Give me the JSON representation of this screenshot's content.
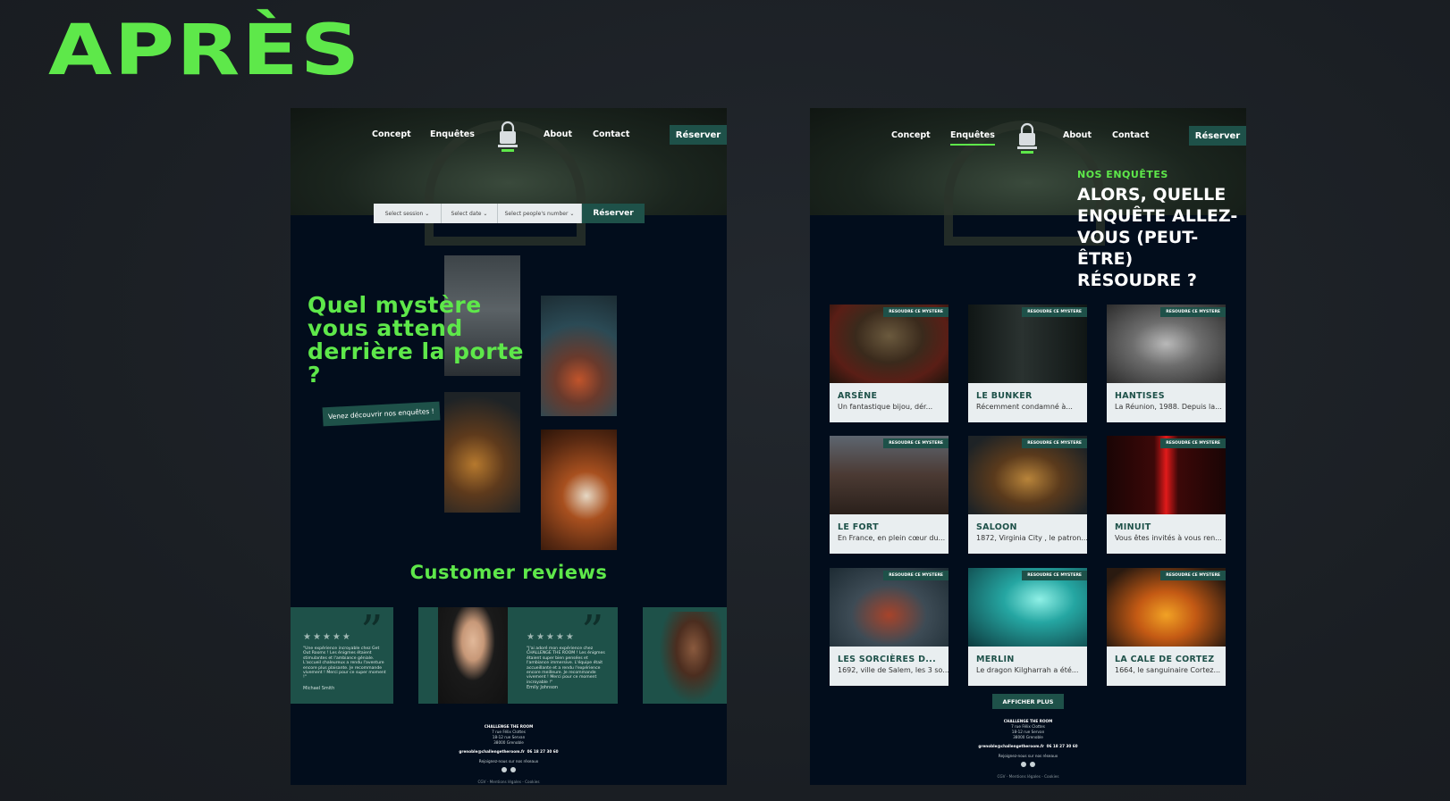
{
  "heading": "APRÈS",
  "nav": {
    "concept": "Concept",
    "enquetes": "Enquêtes",
    "about": "About",
    "contact": "Contact",
    "reserve": "Réserver"
  },
  "booking": {
    "session": "Select session",
    "date": "Select date",
    "people": "Select people's number",
    "button": "Réserver"
  },
  "home": {
    "headline": "Quel mystère vous attend derrière la porte ?",
    "cta": "Venez découvrir nos enquêtes !",
    "reviews_title": "Customer reviews",
    "reviews": [
      {
        "stars": "★★★★★",
        "text": "\"Une expérience incroyable chez Get Out Rooms ! Les énigmes étaient stimulantes et l'ambiance géniale. L'accueil chaleureux a rendu l'aventure encore plus plaisante. Je recommande vivement ! Merci pour ce super moment !\"",
        "name": "Michael Smith"
      },
      {
        "stars": "★★★★★",
        "text": "\"J'ai adoré mon expérience chez CHALLENGE THE ROOM ! Les énigmes étaient super bien pensées et l'ambiance immersive. L'équipe était accueillante et a rendu l'expérience encore meilleure. Je recommande vivement ! Merci pour ce moment incroyable !\"",
        "name": "Emily Johnson"
      }
    ]
  },
  "footer": {
    "name": "CHALLENGE THE ROOM",
    "address": [
      "7 rue Félix Clottes",
      "18-12 rue Servan",
      "38000 Grenoble"
    ],
    "email": "grenoble@challengetheroom.fr",
    "phone": "06 18 27 30 60",
    "follow": "Rejoignez-nous sur nos réseaux",
    "legal": "CGV - Mentions légales - Cookies"
  },
  "enquetes": {
    "kicker": "NOS ENQUÊTES",
    "title": "ALORS, QUELLE ENQUÊTE ALLEZ-VOUS (PEUT-ÊTRE) RÉSOUDRE ?",
    "badge": "RESOUDRE CE MYSTERE",
    "more": "AFFICHER PLUS",
    "cards": [
      {
        "title": "ARSÈNE",
        "desc": "Un fantastique bijou, dér..."
      },
      {
        "title": "LE BUNKER",
        "desc": "Récemment condamné à..."
      },
      {
        "title": "HANTISES",
        "desc": "La Réunion, 1988. Depuis la..."
      },
      {
        "title": "LE FORT",
        "desc": "En France, en plein cœur du..."
      },
      {
        "title": "SALOON",
        "desc": "1872, Virginia City , le patron..."
      },
      {
        "title": "MINUIT",
        "desc": "Vous êtes invités à vous ren..."
      },
      {
        "title": "LES SORCIÈRES D...",
        "desc": "1692, ville de Salem, les 3 so..."
      },
      {
        "title": "MERLIN",
        "desc": "Le dragon Kilgharrah a été..."
      },
      {
        "title": "LA CALE DE CORTEZ",
        "desc": "1664, le sanguinaire Cortez..."
      }
    ]
  },
  "colors": {
    "accent": "#5ee84a",
    "teal": "#1e5149",
    "navy": "#020d1c"
  }
}
